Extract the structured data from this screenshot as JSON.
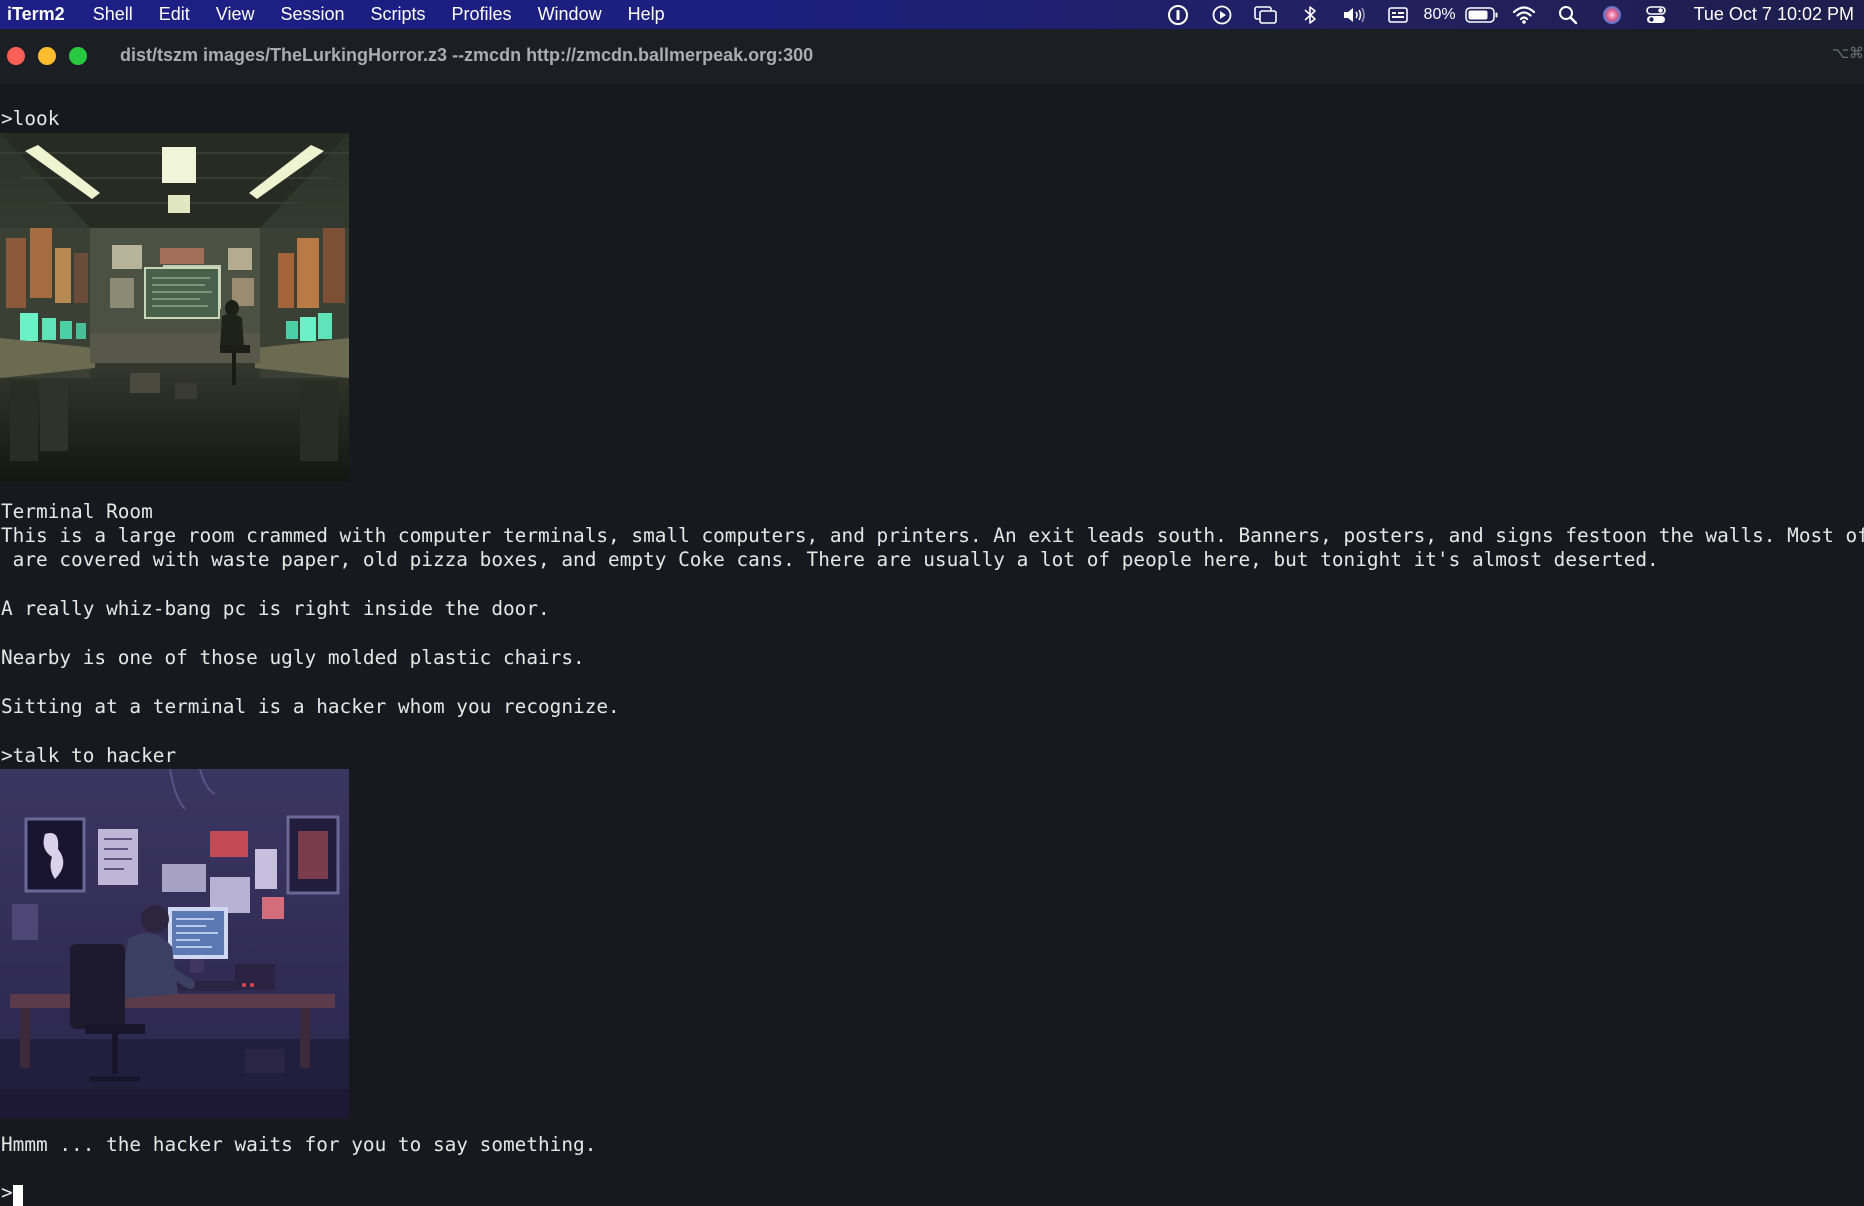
{
  "menubar": {
    "app_name": "iTerm2",
    "items": [
      "Shell",
      "Edit",
      "View",
      "Session",
      "Scripts",
      "Profiles",
      "Window",
      "Help"
    ],
    "status_icons": [
      "1password-icon",
      "play-circle-icon",
      "screen-mirroring-icon",
      "bluetooth-icon",
      "volume-icon",
      "input-source-icon"
    ],
    "battery_percent": "80%",
    "clock": "Tue Oct 7  10:02 PM"
  },
  "window": {
    "title": "dist/tszm images/TheLurkingHorror.z3 --zmcdn http://zmcdn.ballmerpeak.org:300",
    "shortcut": "⌥⌘"
  },
  "terminal": {
    "lines": [
      ">look",
      "Terminal Room",
      "This is a large room crammed with computer terminals, small computers, and printers. An exit leads south. Banners, posters, and signs festoon the walls. Most of the tables",
      " are covered with waste paper, old pizza boxes, and empty Coke cans. There are usually a lot of people here, but tonight it's almost deserted.",
      "A really whiz-bang pc is right inside the door.",
      "Nearby is one of those ugly molded plastic chairs.",
      "Sitting at a terminal is a hacker whom you recognize.",
      ">talk to hacker",
      "Hmmm ... the hacker waits for you to say something.",
      ">"
    ]
  },
  "colors": {
    "terminal_bg": "#161a1f",
    "terminal_fg": "#e6e6e6",
    "menubar_bg": "#1d1f86",
    "close": "#ff5f57",
    "minimize": "#febc2e",
    "zoom": "#28c840"
  }
}
